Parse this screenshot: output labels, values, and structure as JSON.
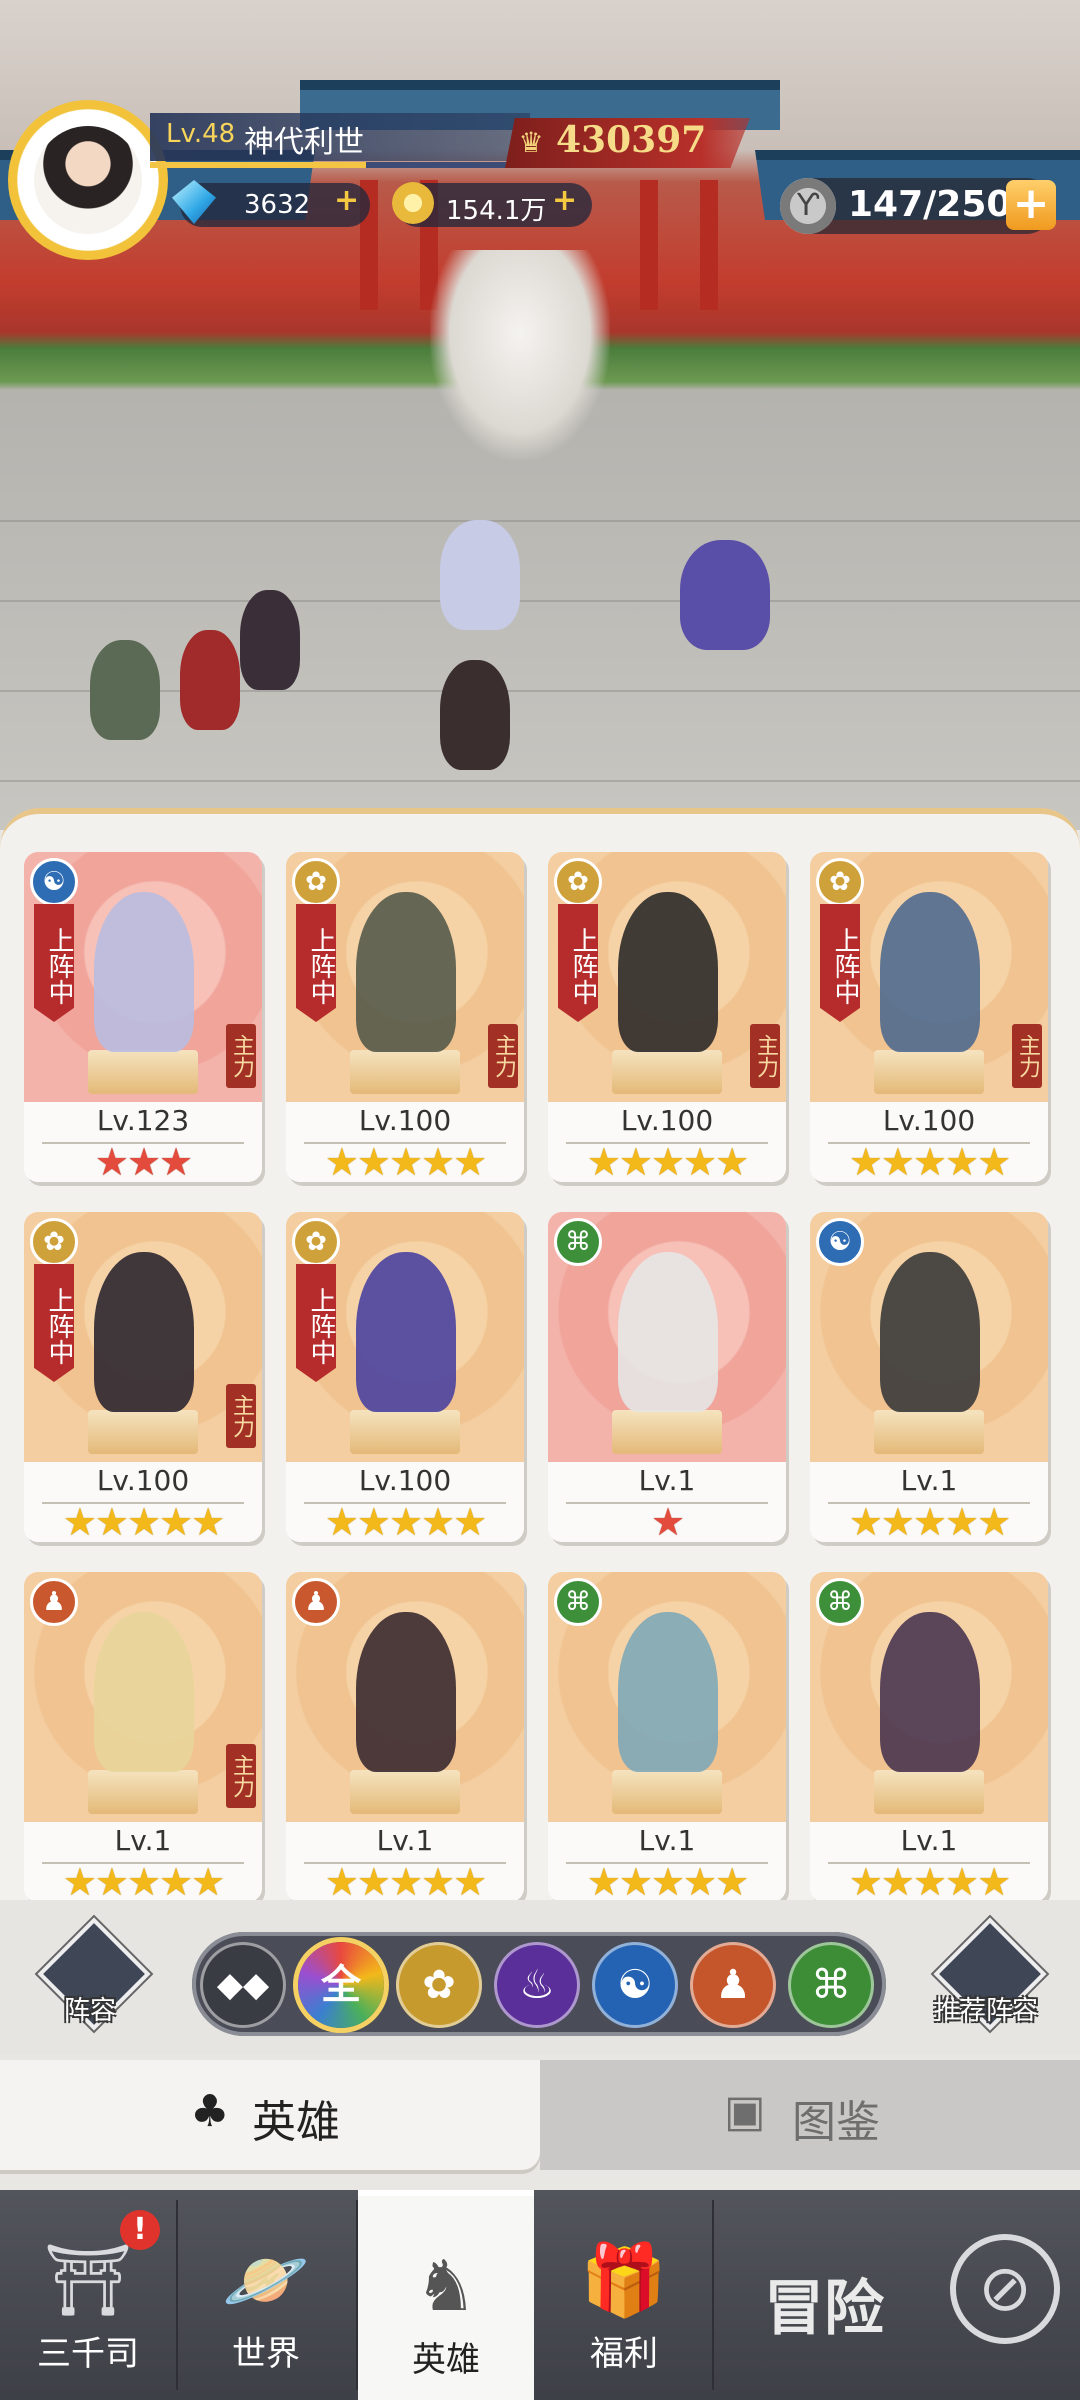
{
  "player": {
    "level": "Lv.48",
    "name": "神代利世",
    "power": "430397",
    "xp_fraction": 0.6
  },
  "resources": {
    "gems": "3632",
    "coins": "154.1万",
    "stamina": "147/250"
  },
  "heroes": [
    {
      "level": "Lv.123",
      "stars": "★★★",
      "star_color": "red",
      "faction": "blue",
      "deployed": true,
      "main": true,
      "bg": "red"
    },
    {
      "level": "Lv.100",
      "stars": "★★★★★",
      "star_color": "gold",
      "faction": "gold",
      "deployed": true,
      "main": true,
      "bg": "orange"
    },
    {
      "level": "Lv.100",
      "stars": "★★★★★",
      "star_color": "gold",
      "faction": "gold",
      "deployed": true,
      "main": true,
      "bg": "orange"
    },
    {
      "level": "Lv.100",
      "stars": "★★★★★",
      "star_color": "gold",
      "faction": "gold",
      "deployed": true,
      "main": true,
      "bg": "orange"
    },
    {
      "level": "Lv.100",
      "stars": "★★★★★",
      "star_color": "gold",
      "faction": "gold",
      "deployed": true,
      "main": true,
      "bg": "orange"
    },
    {
      "level": "Lv.100",
      "stars": "★★★★★",
      "star_color": "gold",
      "faction": "gold",
      "deployed": true,
      "main": false,
      "bg": "orange"
    },
    {
      "level": "Lv.1",
      "stars": "★",
      "star_color": "red",
      "faction": "green",
      "deployed": false,
      "main": false,
      "bg": "red"
    },
    {
      "level": "Lv.1",
      "stars": "★★★★★",
      "star_color": "gold",
      "faction": "blue",
      "deployed": false,
      "main": false,
      "bg": "orange"
    },
    {
      "level": "Lv.1",
      "stars": "★★★★★",
      "star_color": "gold",
      "faction": "orange",
      "deployed": false,
      "main": true,
      "bg": "orange"
    },
    {
      "level": "Lv.1",
      "stars": "★★★★★",
      "star_color": "gold",
      "faction": "orange",
      "deployed": false,
      "main": false,
      "bg": "orange"
    },
    {
      "level": "Lv.1",
      "stars": "★★★★★",
      "star_color": "gold",
      "faction": "green",
      "deployed": false,
      "main": false,
      "bg": "orange"
    },
    {
      "level": "Lv.1",
      "stars": "★★★★★",
      "star_color": "gold",
      "faction": "green",
      "deployed": false,
      "main": false,
      "bg": "orange"
    }
  ],
  "labels": {
    "deployed": "上阵中",
    "main": "主力"
  },
  "filter": {
    "lineup": "阵容",
    "recommended": "推荐阵容",
    "all": "全"
  },
  "tabs": {
    "heroes": "英雄",
    "codex": "图鉴"
  },
  "nav": {
    "sanqiansi": "三千司",
    "world": "世界",
    "heroes": "英雄",
    "welfare": "福利",
    "adventure": "冒险"
  },
  "colors": {
    "accent_gold": "#f3b81a",
    "deploy_red": "#b62c2c"
  }
}
